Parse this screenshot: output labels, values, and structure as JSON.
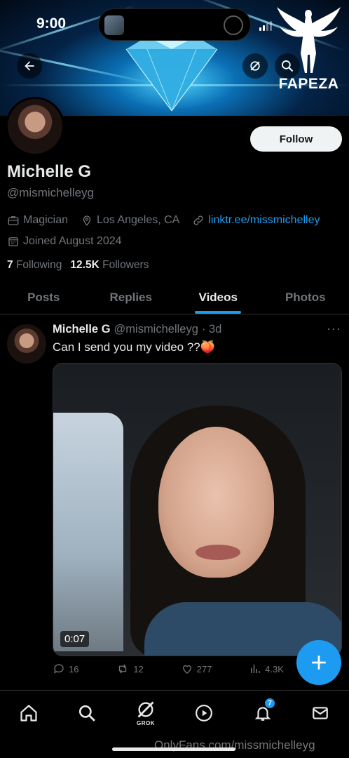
{
  "status_bar": {
    "time": "9:00"
  },
  "watermark": {
    "text": "FAPEZA"
  },
  "profile": {
    "display_name": "Michelle G",
    "handle": "@mismichelleyg",
    "follow_label": "Follow",
    "occupation": "Magician",
    "location": "Los Angeles, CA",
    "link": "linktr.ee/missmichelley",
    "joined": "Joined August 2024",
    "following_count": "7",
    "following_label": "Following",
    "followers_count": "12.5K",
    "followers_label": "Followers"
  },
  "tabs": [
    {
      "label": "Posts"
    },
    {
      "label": "Replies"
    },
    {
      "label": "Videos",
      "active": true
    },
    {
      "label": "Photos"
    }
  ],
  "post": {
    "name": "Michelle G",
    "handle": "@mismichelleyg",
    "time": "· 3d",
    "text": "Can I send you my video ??🍑",
    "video_duration": "0:07",
    "replies": "16",
    "reposts": "12",
    "likes": "277",
    "views": "4.3K"
  },
  "bottom_nav": {
    "grok_label": "GROK",
    "notifications_badge": "7"
  },
  "overlay_watermark": "OnlyFans.com/missmichelleyg",
  "colors": {
    "accent": "#1d9bf0",
    "background": "#000000",
    "muted": "#71767b"
  }
}
